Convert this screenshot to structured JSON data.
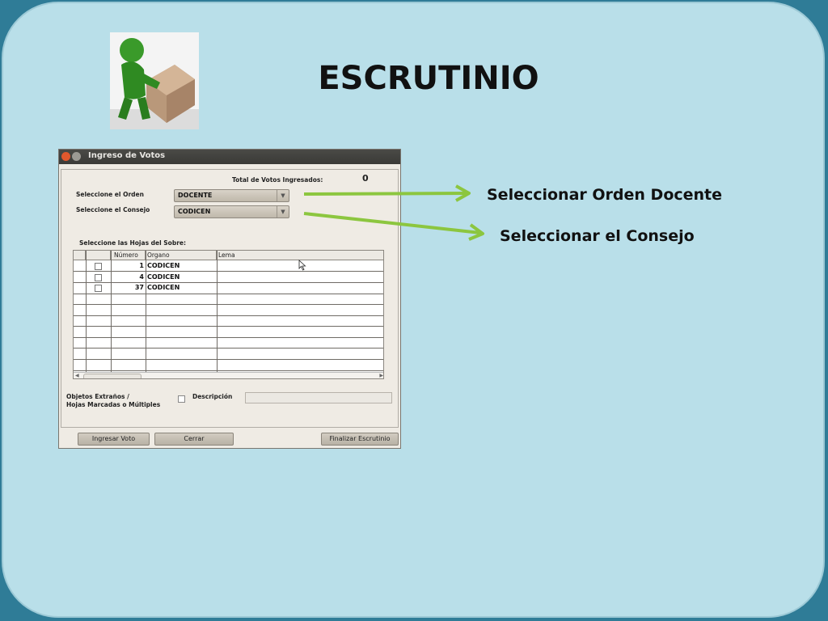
{
  "slide": {
    "title": "ESCRUTINIO",
    "callouts": {
      "orden": "Seleccionar Orden Docente",
      "consejo": "Seleccionar el Consejo"
    },
    "accent_color": "#8cc63f"
  },
  "window": {
    "title": "Ingreso de Votos",
    "total_label": "Total de Votos Ingresados:",
    "total_value": "0",
    "orden_label": "Seleccione el Orden",
    "orden_value": "DOCENTE",
    "consejo_label": "Seleccione el Consejo",
    "consejo_value": "CODICEN",
    "hojas_label": "Seleccione las Hojas del Sobre:",
    "table": {
      "headers": [
        "Número",
        "Organo",
        "Lema"
      ],
      "rows": [
        {
          "numero": "1",
          "organo": "CODICEN",
          "lema": ""
        },
        {
          "numero": "4",
          "organo": "CODICEN",
          "lema": ""
        },
        {
          "numero": "37",
          "organo": "CODICEN",
          "lema": ""
        }
      ]
    },
    "objetos_label_1": "Objetos Extraños /",
    "objetos_label_2": "Hojas Marcadas o Múltiples",
    "descripcion_label": "Descripción",
    "buttons": {
      "ingresar": "Ingresar Voto",
      "cerrar": "Cerrar",
      "finalizar": "Finalizar Escrutinio"
    }
  }
}
